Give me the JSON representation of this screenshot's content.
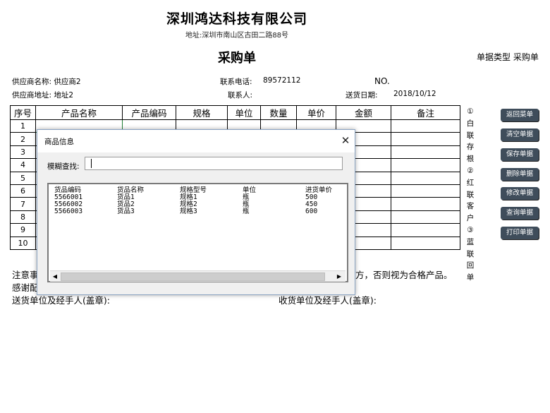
{
  "header": {
    "company": "深圳鸿达科技有限公司",
    "address": "地址:深圳市南山区古田二路88号",
    "title": "采购单",
    "doc_type": "单据类型 采购单"
  },
  "info": {
    "supplier_name": "供应商名称: 供应商2",
    "phone_label": "联系电话:",
    "phone_value": "89572112",
    "no_label": "NO.",
    "supplier_address": "供应商地址: 地址2",
    "contact_label": "联系人:",
    "delivery_label": "送货日期:",
    "delivery_value": "2018/10/12"
  },
  "table": {
    "headers": [
      "序号",
      "产品名称",
      "产品编码",
      "规格",
      "单位",
      "数量",
      "单价",
      "金额",
      "备注"
    ],
    "rows": [
      "1",
      "2",
      "3",
      "4",
      "5",
      "6",
      "7",
      "8",
      "9",
      "10"
    ]
  },
  "vertical_note": [
    "①",
    "白",
    "联",
    "存",
    "根",
    "②",
    "红",
    "联",
    "客",
    "户",
    "③",
    "蓝",
    "联",
    "回",
    "单"
  ],
  "side_buttons": [
    "返回菜单",
    "清空单据",
    "保存单据",
    "删除单据",
    "修改单据",
    "查询单据",
    "打印单据"
  ],
  "footer": {
    "note_left": "注意事",
    "note_right": "方，否则视为合格产品。",
    "thanks": "感谢配",
    "sender": "送货单位及经手人(盖章):",
    "receiver": "收货单位及经手人(盖章):"
  },
  "dialog": {
    "title": "商品信息",
    "close": "✕",
    "search_label": "模糊查找:",
    "search_value": "",
    "columns": [
      "货品编码",
      "货品名称",
      "规格型号",
      "单位",
      "进货单价"
    ],
    "items": [
      [
        "5566001",
        "货品1",
        "规格1",
        "瓶",
        "500"
      ],
      [
        "5566002",
        "货品2",
        "规格2",
        "瓶",
        "450"
      ],
      [
        "5566003",
        "货品3",
        "规格3",
        "瓶",
        "600"
      ]
    ],
    "scroll_left": "◀",
    "scroll_right": "▶"
  }
}
